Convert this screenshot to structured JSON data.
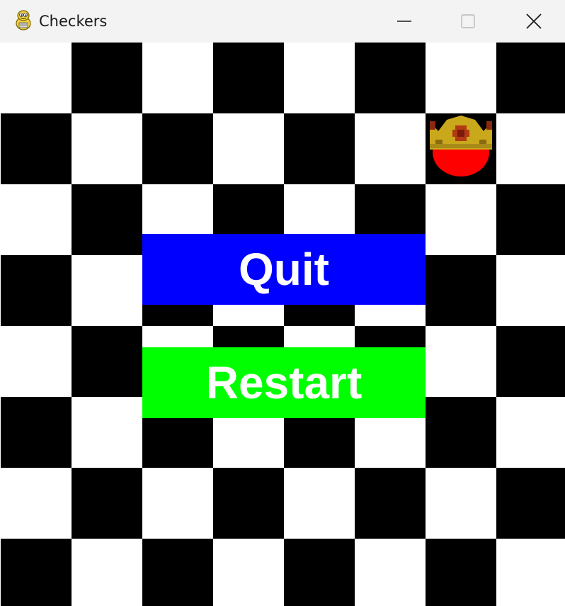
{
  "window": {
    "title": "Checkers",
    "app_icon": "python-snake-icon",
    "controls": [
      "minimize-icon",
      "maximize-icon",
      "close-icon"
    ]
  },
  "board": {
    "colors": {
      "light": "#ffffff",
      "dark": "#000000"
    }
  },
  "pieces": [
    {
      "type": "king",
      "color": "#ff0000",
      "crown_color": "#c9a81c",
      "icon": "crown-icon"
    }
  ],
  "menu": {
    "quit_label": "Quit",
    "restart_label": "Restart",
    "quit_color": "#0000ff",
    "restart_color": "#00ff00"
  }
}
